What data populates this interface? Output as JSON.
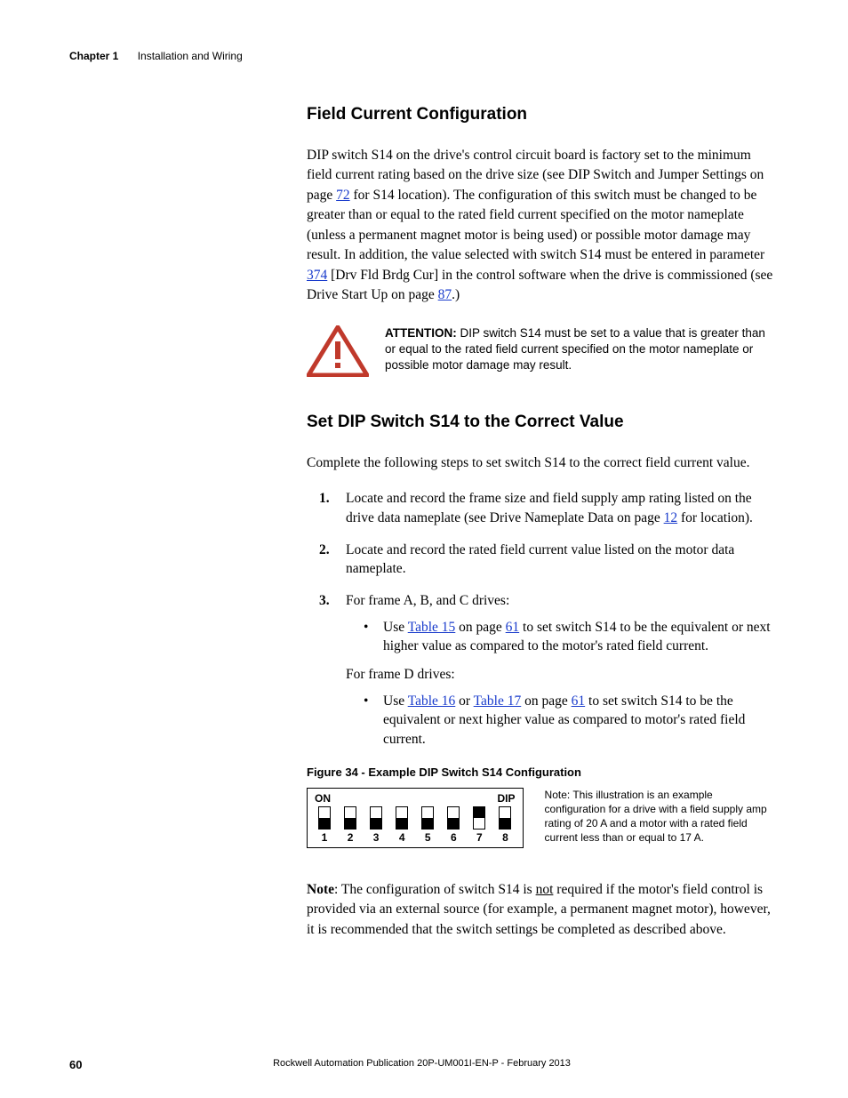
{
  "header": {
    "chapter": "Chapter 1",
    "title": "Installation and Wiring"
  },
  "h2_a": "Field Current Configuration",
  "para_a_pre": "DIP switch S14 on the drive's control circuit board is factory set to the minimum field current rating based on the drive size (see DIP Switch and Jumper Settings on page ",
  "link72": "72",
  "para_a_mid": " for S14 location). The configuration of this switch must be changed to be greater than or equal to the rated field current specified on the motor nameplate (unless a permanent magnet motor is being used) or possible motor damage may result. In addition, the value selected with switch S14 must be entered in parameter ",
  "link374": "374",
  "para_a_mid2": " [Drv Fld Brdg Cur] in the control software when the drive is commissioned (see Drive Start Up on page ",
  "link87": "87",
  "para_a_end": ".)",
  "attention": {
    "lead": "ATTENTION:",
    "text": " DIP switch S14 must be set to a value that is greater than or equal to the rated field current specified on the motor nameplate or possible motor damage may result."
  },
  "h2_b": "Set DIP Switch S14 to the Correct Value",
  "para_b": "Complete the following steps to set switch S14 to the correct field current value.",
  "step1_pre": "Locate and record the frame size and field supply amp rating listed on the drive data nameplate (see Drive Nameplate Data on page ",
  "link12": "12",
  "step1_post": " for location).",
  "step2": "Locate and record the rated field current value listed on the motor data nameplate.",
  "step3_intro": "For frame A, B, and C drives:",
  "step3_b1_pre": "Use ",
  "link_t15": "Table 15",
  "step3_b1_mid": " on page ",
  "link61a": "61",
  "step3_b1_post": " to set switch S14 to be the equivalent or next higher value as compared to the motor's rated field current.",
  "step3_frameD": "For frame D drives:",
  "step3_b2_pre": "Use ",
  "link_t16": "Table 16",
  "step3_b2_or": " or ",
  "link_t17": "Table 17",
  "step3_b2_mid": " on page ",
  "link61b": "61",
  "step3_b2_post": " to set switch S14 to be the equivalent or next higher value as compared to motor's rated field current.",
  "fig_caption": "Figure 34 - Example DIP Switch S14 Configuration",
  "dip": {
    "label_on": "ON",
    "label_dip": "DIP",
    "switches": [
      {
        "num": "1",
        "state": "off"
      },
      {
        "num": "2",
        "state": "off"
      },
      {
        "num": "3",
        "state": "off"
      },
      {
        "num": "4",
        "state": "off"
      },
      {
        "num": "5",
        "state": "off"
      },
      {
        "num": "6",
        "state": "off"
      },
      {
        "num": "7",
        "state": "on"
      },
      {
        "num": "8",
        "state": "off"
      }
    ]
  },
  "fig_note": "Note: This illustration is an example configuration for a drive with a field supply amp rating of 20 A and a motor with a rated field current less than or equal to 17 A.",
  "note_lead": "Note",
  "note_pre": ": The configuration of switch S14 is ",
  "note_not": "not",
  "note_post": " required if the motor's field control is provided via an external source (for example, a permanent magnet motor), however, it is recommended that the switch settings be completed as described above.",
  "footer": {
    "page": "60",
    "pub": "Rockwell Automation Publication 20P-UM001I-EN-P - February 2013"
  }
}
